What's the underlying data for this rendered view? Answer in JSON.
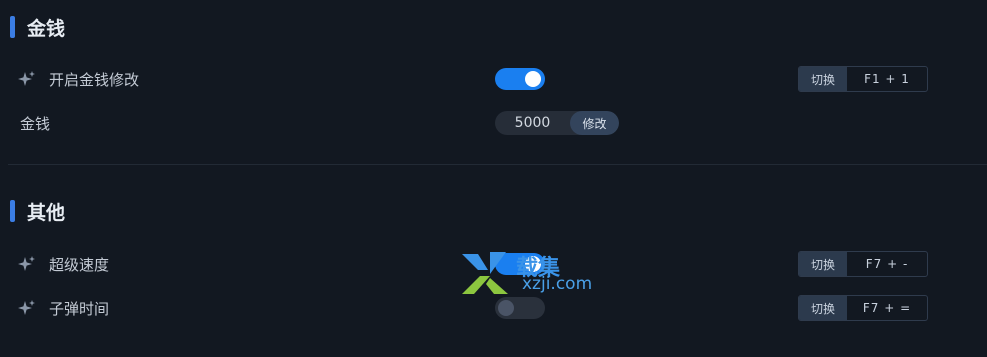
{
  "sections": [
    {
      "title": "金钱"
    },
    {
      "title": "其他"
    }
  ],
  "money": {
    "enable": {
      "label": "开启金钱修改",
      "state": "on",
      "switch_label": "切换",
      "hotkey": "F1 + 1"
    },
    "amount": {
      "label": "金钱",
      "value": "5000",
      "button": "修改"
    }
  },
  "other": {
    "speed": {
      "label": "超级速度",
      "state": "on",
      "switch_label": "切换",
      "hotkey": "F7 + -"
    },
    "bullet": {
      "label": "子弹时间",
      "state": "off",
      "switch_label": "切换",
      "hotkey": "F7 + ="
    }
  },
  "watermark": {
    "cn": "载集",
    "en": "xzji.com"
  },
  "colors": {
    "accent": "#1a7ff0",
    "background": "#121821"
  }
}
